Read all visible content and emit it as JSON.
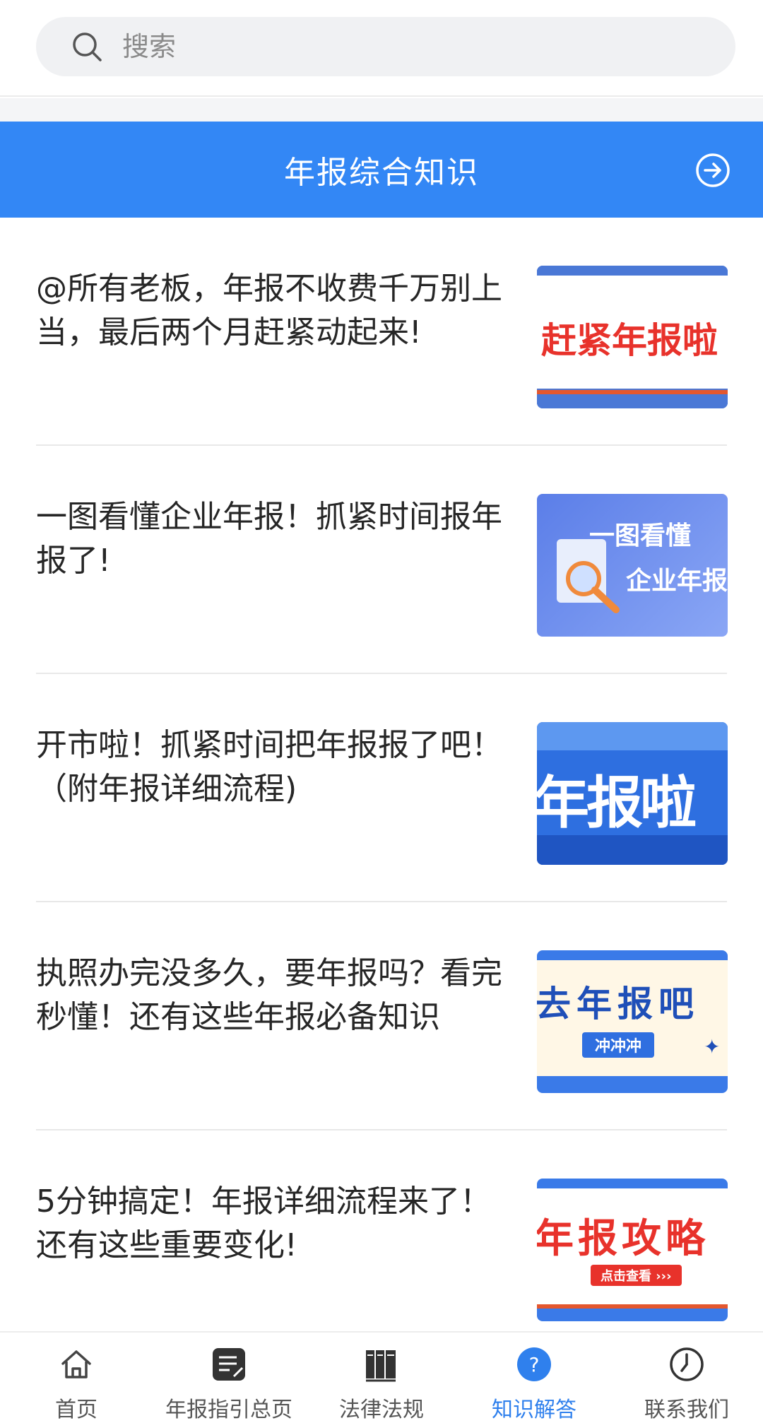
{
  "search": {
    "placeholder": "搜索"
  },
  "section": {
    "title": "年报综合知识"
  },
  "articles": [
    {
      "title": "@所有老板，年报不收费千万别上当，最后两个月赶紧动起来!",
      "thumb_text": "赶紧年报啦"
    },
    {
      "title": "一图看懂企业年报！抓紧时间报年报了!",
      "thumb_text_1": "一图看懂",
      "thumb_text_2": "企业年报"
    },
    {
      "title": "开市啦！抓紧时间把年报报了吧！（附年报详细流程)",
      "thumb_text": "年报啦"
    },
    {
      "title": "执照办完没多久，要年报吗？看完秒懂！还有这些年报必备知识",
      "thumb_text": "去年报吧",
      "thumb_badge": "冲冲冲"
    },
    {
      "title": "5分钟搞定！年报详细流程来了！还有这些重要变化!",
      "thumb_text": "年报攻略",
      "thumb_badge": "点击查看 ›››"
    }
  ],
  "tabs": [
    {
      "label": "首页",
      "icon": "home-icon"
    },
    {
      "label": "年报指引总页",
      "icon": "document-icon"
    },
    {
      "label": "法律法规",
      "icon": "books-icon"
    },
    {
      "label": "知识解答",
      "icon": "question-icon",
      "active": true
    },
    {
      "label": "联系我们",
      "icon": "clock-icon"
    }
  ],
  "colors": {
    "primary": "#3387f5",
    "active_tab": "#2f80ed"
  }
}
